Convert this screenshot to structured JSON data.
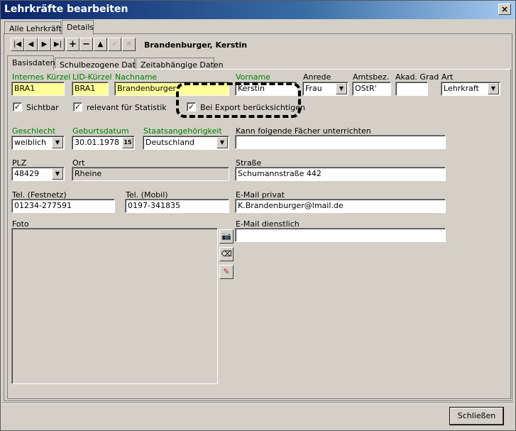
{
  "window": {
    "title": "Lehrkräfte bearbeiten",
    "close": "×"
  },
  "main_tabs": [
    "Alle Lehrkräfte",
    "Details"
  ],
  "toolbar": {
    "first": "|◀",
    "prev": "◀",
    "next": "▶",
    "last": "▶|",
    "add": "+",
    "remove": "−",
    "up": "▲",
    "confirm": "✓",
    "cancel": "✕"
  },
  "record_name": "Brandenburger, Kerstin",
  "sub_tabs": [
    "Basisdaten",
    "Schulbezogene Daten",
    "Zeitabhängige Daten"
  ],
  "labels": {
    "kuerzel": "Internes Kürzel",
    "lid": "LID-Kürzel",
    "nachname": "Nachname",
    "vorname": "Vorname",
    "anrede": "Anrede",
    "amtsbez": "Amtsbez.",
    "akad": "Akad. Grad",
    "art": "Art",
    "sichtbar": "Sichtbar",
    "statistik": "relevant für Statistik",
    "export": "Bei Export berücksichtigen",
    "geschlecht": "Geschlecht",
    "geburtsdatum": "Geburtsdatum",
    "staat": "Staatsangehörigkeit",
    "faecher": "Kann folgende Fächer unterrichten",
    "plz": "PLZ",
    "ort": "Ort",
    "strasse": "Straße",
    "tel_fest": "Tel. (Festnetz)",
    "tel_mobil": "Tel. (Mobil)",
    "email_privat": "E-Mail privat",
    "foto": "Foto",
    "email_dienst": "E-Mail dienstlich"
  },
  "values": {
    "kuerzel": "BRA1",
    "lid": "BRA1",
    "nachname": "Brandenburger",
    "vorname": "Kerstin",
    "anrede": "Frau",
    "amtsbez": "OStR'",
    "akad": "",
    "art": "Lehrkraft",
    "geschlecht": "weiblich",
    "geburtsdatum": "30.01.1978",
    "calendar_day": "15",
    "staat": "Deutschland",
    "faecher": "",
    "plz": "48429",
    "ort": "Rheine",
    "strasse": "Schumannstraße 442",
    "tel_fest": "01234-277591",
    "tel_mobil": "0197-341835",
    "email_privat": "K.Brandenburger@lmail.de",
    "email_dienst": ""
  },
  "checks": {
    "sichtbar": "✓",
    "statistik": "✓",
    "export": "✓"
  },
  "combo_arrow": "▼",
  "photo_buttons": {
    "camera": "📷",
    "eraser": "⌫",
    "edit": "✎"
  },
  "footer": {
    "close": "Schließen"
  }
}
